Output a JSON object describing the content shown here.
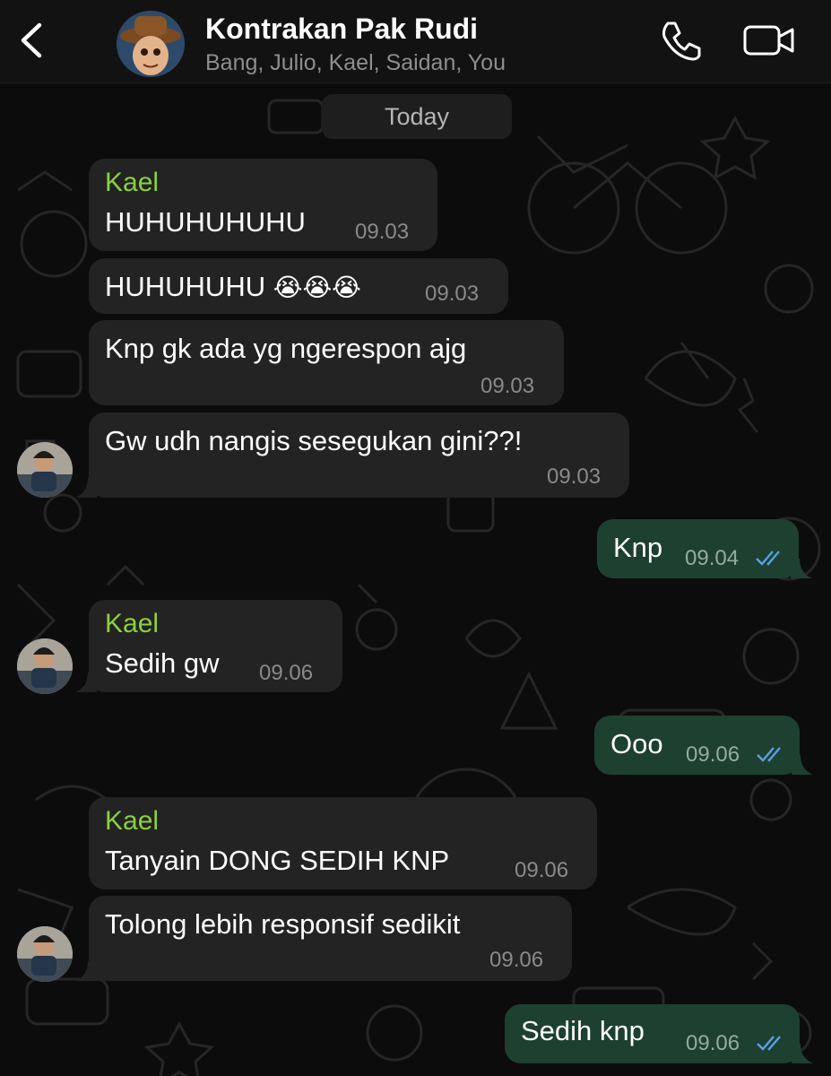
{
  "header": {
    "title": "Kontrakan Pak Rudi",
    "participants": "Bang, Julio, Kael, Saidan, You"
  },
  "day_label": "Today",
  "messages": [
    {
      "sender": "Kael",
      "text": "HUHUHUHUHU",
      "time": "09.03",
      "direction": "in"
    },
    {
      "sender": "",
      "text": "HUHUHUHU",
      "emoji": "😭😭😭",
      "time": "09.03",
      "direction": "in"
    },
    {
      "sender": "",
      "text": "Knp gk ada yg ngerespon ajg",
      "time": "09.03",
      "direction": "in"
    },
    {
      "sender": "",
      "text": "Gw udh nangis sesegukan gini??!",
      "time": "09.03",
      "direction": "in"
    },
    {
      "sender": "",
      "text": "Knp",
      "time": "09.04",
      "direction": "out",
      "status": "read"
    },
    {
      "sender": "Kael",
      "text": "Sedih gw",
      "time": "09.06",
      "direction": "in"
    },
    {
      "sender": "",
      "text": "Ooo",
      "time": "09.06",
      "direction": "out",
      "status": "read"
    },
    {
      "sender": "Kael",
      "text": "Tanyain DONG SEDIH KNP",
      "time": "09.06",
      "direction": "in"
    },
    {
      "sender": "",
      "text": "Tolong lebih responsif sedikit",
      "time": "09.06",
      "direction": "in"
    },
    {
      "sender": "",
      "text": "Sedih knp",
      "time": "09.06",
      "direction": "out",
      "status": "read"
    }
  ],
  "colors": {
    "background": "#0c0c0c",
    "incoming_bubble": "#232323",
    "outgoing_bubble": "#1d4030",
    "sender_name": "#8bd13f",
    "read_ticks": "#5aa0e6"
  },
  "icons": {
    "back": "chevron-left-icon",
    "call": "phone-icon",
    "video": "video-camera-icon",
    "read": "double-check-icon"
  }
}
